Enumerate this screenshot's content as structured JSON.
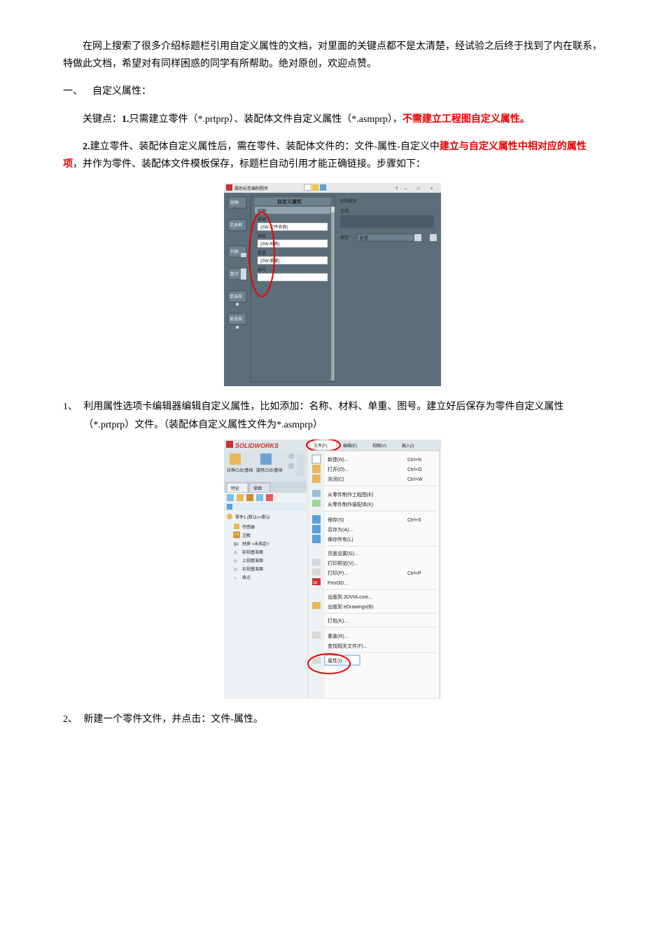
{
  "intro": "在网上搜索了很多介绍标题栏引用自定义属性的文档，对里面的关键点都不是太清楚，经试验之后终于找到了内在联系，特做此文档，希望对有同样困惑的同学有所帮助。绝对原创，欢迎点赞。",
  "sec1": {
    "num": "一、",
    "title": "自定义属性："
  },
  "key": {
    "label": "关键点：",
    "p1a": "1.",
    "p1b": "只需建立零件（*.prtprp）、装配体文件自定义属性（*.asmprp），",
    "p1c": "不需建立工程图自定义属性。",
    "p2a": "2.",
    "p2b": "建立零件、装配体自定义属性后，需在零件、装配体文件的：文件-属性-自定义中",
    "p2c": "建立与自定义属性中相对应的属性项",
    "p2d": "，并作为零件、装配体文件模板保存，标题栏自动引用才能正确链接。步骤如下："
  },
  "fig1": {
    "title": "属性标签编制程序",
    "grouptitle": "自定义属性",
    "labels": {
      "xs": "组框",
      "wbk": "文本框",
      "lb": "列表",
      "sz": "数字",
      "dxk": "单选按",
      "fxk": "复选按"
    },
    "ctrl": {
      "pane": "控制属性",
      "msg": "信息:",
      "type": "类型:",
      "val": "配置"
    },
    "fields": {
      "name_lbl": "名称",
      "name_val": "{SW-文件名称}",
      "mat_lbl": "材料",
      "mat_val": "{SW-材质}",
      "wt_lbl": "单重",
      "wt_val": "{SW-质量}",
      "no_lbl": "图号",
      "no_val": ""
    }
  },
  "step1": {
    "num": "1、",
    "text": "利用属性选项卡编辑器编辑自定义属性，比如添加：名称、材料、单重、图号。建立好后保存为零件自定义属性（*.prtprp）文件。（装配体自定义属性文件为*.asmprp）"
  },
  "fig2": {
    "brand": "SOLIDWORKS",
    "menutabs": {
      "file": "文件(F)",
      "edit": "编辑(E)",
      "view": "视图(V)",
      "insert": "插入(I)"
    },
    "tbar": {
      "lscc": "拉伸凸台/基体",
      "xzc": "旋转凸台/基体"
    },
    "tabs": {
      "tz": "特征",
      "ct": "草图"
    },
    "tree": {
      "root": "零件1 (默认<<默认",
      "cgq": "传感器",
      "zj": "注解",
      "cz": "材质 <未指定>",
      "qjm": "前视基准面",
      "sjm": "上视基准面",
      "yjm": "右视基准面",
      "yd": "原点"
    },
    "menu": {
      "new": "新建(N)...",
      "open": "打开(O)...",
      "close": "关闭(C)",
      "fromdw": "从零件制作工程图(E)",
      "fromasm": "从零件制作装配体(K)",
      "save": "保存(S)",
      "saveas": "另存为(A)...",
      "saveall": "保存所有(L)",
      "page": "页面设置(G)...",
      "preview": "打印预览(V)...",
      "print": "打印(P)...",
      "p3d": "Print3D...",
      "pub3dvia": "出版到 3DVIA.com...",
      "pubedrw": "出版到 eDrawings(B)",
      "pack": "打包(K)...",
      "reload": "重装(R)...",
      "findref": "查找相关文件(F)...",
      "props": "属性(I)..."
    },
    "short": {
      "new": "Ctrl+N",
      "open": "Ctrl+O",
      "close": "Ctrl+W",
      "save": "Ctrl+S",
      "print": "Ctrl+P"
    }
  },
  "step2": {
    "num": "2、",
    "text": "新建一个零件文件，并点击：文件-属性。"
  }
}
